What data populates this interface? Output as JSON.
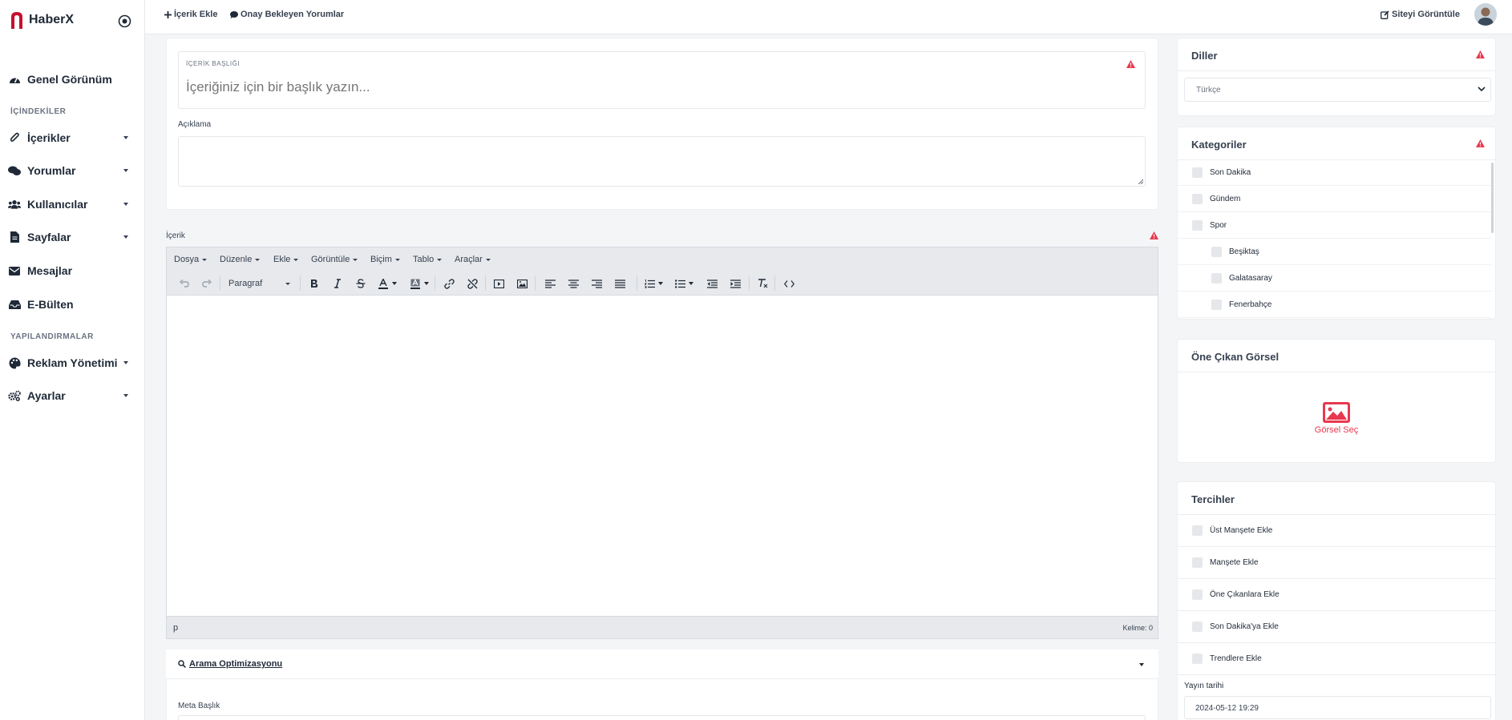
{
  "brand": {
    "name": "HaberX"
  },
  "sidebar": {
    "sections": {
      "contents": "İÇİNDEKİLER",
      "config": "YAPILANDIRMALAR"
    },
    "items": [
      {
        "label": "Genel Görünüm",
        "icon": "dashboard-icon"
      },
      {
        "label": "İçerikler",
        "icon": "paperclip-icon"
      },
      {
        "label": "Yorumlar",
        "icon": "comments-icon"
      },
      {
        "label": "Kullanıcılar",
        "icon": "users-icon"
      },
      {
        "label": "Sayfalar",
        "icon": "file-icon"
      },
      {
        "label": "Mesajlar",
        "icon": "envelope-icon"
      },
      {
        "label": "E-Bülten",
        "icon": "inbox-icon"
      },
      {
        "label": "Reklam Yönetimi",
        "icon": "palette-icon"
      },
      {
        "label": "Ayarlar",
        "icon": "gears-icon"
      }
    ]
  },
  "topbar": {
    "add_content": "İçerik Ekle",
    "pending_comments": "Onay Bekleyen Yorumlar",
    "view_site": "Siteyi Görüntüle"
  },
  "form": {
    "title_label": "İÇERİK BAŞLIĞI",
    "title_placeholder": "İçeriğiniz için bir başlık yazın...",
    "description_label": "Açıklama",
    "content_label": "İçerik"
  },
  "editor": {
    "menus": [
      "Dosya",
      "Düzenle",
      "Ekle",
      "Görüntüle",
      "Biçim",
      "Tablo",
      "Araçlar"
    ],
    "format": "Paragraf",
    "path": "p",
    "word_count": "Kelime: 0"
  },
  "seo": {
    "title": "Arama Optimizasyonu",
    "meta_title_label": "Meta Başlık"
  },
  "right": {
    "languages": {
      "title": "Diller",
      "selected": "Türkçe"
    },
    "categories": {
      "title": "Kategoriler",
      "items": [
        "Son Dakika",
        "Gündem",
        "Spor",
        "Beşiktaş",
        "Galatasaray",
        "Fenerbahçe"
      ]
    },
    "featured": {
      "title": "Öne Çıkan Görsel",
      "choose": "Görsel Seç"
    },
    "preferences": {
      "title": "Tercihler",
      "items": [
        "Üst Manşete Ekle",
        "Manşete Ekle",
        "Öne Çıkanlara Ekle",
        "Son Dakika'ya Ekle",
        "Trendlere Ekle"
      ],
      "date_label": "Yayın tarihi",
      "date_value": "2024-05-12 19:29"
    }
  },
  "colors": {
    "accent": "#e8384f",
    "warning": "#e8384f"
  }
}
